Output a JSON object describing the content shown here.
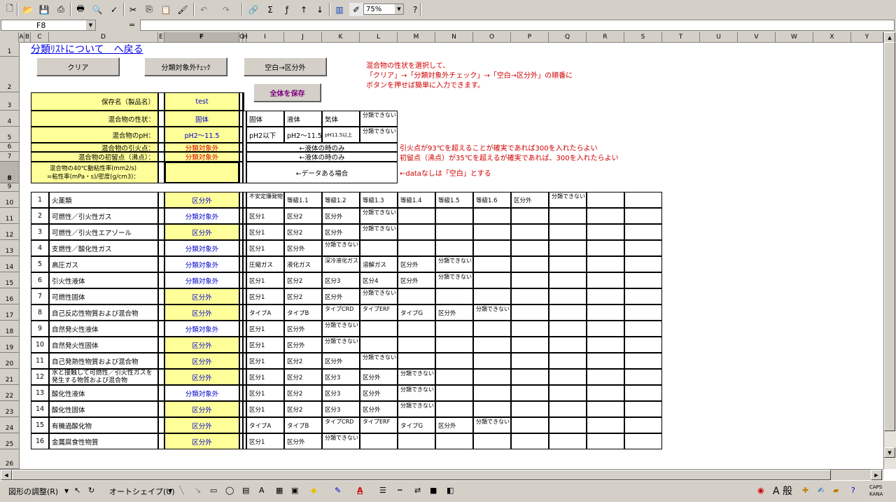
{
  "toolbar": {
    "zoom": "75%",
    "icons": [
      "new-icon",
      "open-icon",
      "save-icon",
      "print-setup-icon",
      "print-icon",
      "preview-icon",
      "spell-icon",
      "cut-icon",
      "copy-icon",
      "paste-icon",
      "format-painter-icon",
      "undo-icon",
      "redo-icon",
      "hyperlink-icon",
      "sum-icon",
      "function-icon",
      "sort-asc-icon",
      "sort-desc-icon",
      "chart-icon",
      "drawing-icon",
      "help-icon"
    ],
    "fx_glyph": "fx",
    "sigma_glyph": "Σ"
  },
  "formula_bar": {
    "name_box": "F8",
    "equals": "=",
    "value": ""
  },
  "columns": [
    "A",
    "B",
    "C",
    "D",
    "E",
    "F",
    "G",
    "H",
    "I",
    "J",
    "K",
    "L",
    "M",
    "N",
    "O",
    "P",
    "Q",
    "R",
    "S",
    "T",
    "U",
    "V",
    "W",
    "X",
    "Y"
  ],
  "rows": [
    "1",
    "2",
    "3",
    "4",
    "5",
    "6",
    "7",
    "8",
    "9",
    "10",
    "11",
    "12",
    "13",
    "14",
    "15",
    "16",
    "17",
    "18",
    "19",
    "20",
    "21",
    "22",
    "23",
    "24",
    "25",
    "26"
  ],
  "selected_cell": {
    "column": "F",
    "row": "8"
  },
  "sheet": {
    "link": "分類ﾘｽﾄについて　へ戻る",
    "buttons": {
      "clear": "クリア",
      "excluded_check": "分類対象外ﾁｪｯｸ",
      "blank_to_category": "空白→区分外",
      "save_all": "全体を保存"
    },
    "instructions": [
      "混合物の性状を選択して、",
      "「クリア」→「分類対象外チェック」→「空白→区分外」の順番に",
      "ボタンを押せば簡単に入力できます。"
    ],
    "props": [
      {
        "label": "保存名（製品名）",
        "value": "test",
        "color": "blue"
      },
      {
        "label": "混合物の性状：",
        "value": "固体",
        "color": "blue"
      },
      {
        "label": "混合物のpH：",
        "value": "pH2～11.5",
        "color": "blue"
      },
      {
        "label": "混合物の引火点：",
        "value": "分類対象外",
        "color": "red"
      },
      {
        "label": "混合物の初留点（沸点）：",
        "value": "分類対象外",
        "color": "red"
      },
      {
        "label": "混合物の40℃動粘性率(mm2/s)\n=粘性率(mPa・s)/密度(g/cm3)：",
        "value": "",
        "color": "blue"
      }
    ],
    "state_options": [
      "固体",
      "液体",
      "気体",
      "分類できない"
    ],
    "ph_options": [
      "pH2以下",
      "pH2～11.5",
      "pH11.5以上",
      "分類できない"
    ],
    "liquid_only_1": "←液体の時のみ",
    "liquid_only_2": "←液体の時のみ",
    "data_case": "←データある場合",
    "note_flash": "引火点が93℃を超えることが確実であれば300を入れたらよい",
    "note_boil": "初留点（沸点）が35℃を超えるが確実であれば、300を入れたらよい",
    "note_data": "←dataなしは「空白」とする",
    "hazards": [
      {
        "no": "1",
        "name": "火薬類",
        "result": "区分外",
        "opts": [
          "不安定爆発物",
          "等級1.1",
          "等級1.2",
          "等級1.3",
          "等級1.4",
          "等級1.5",
          "等級1.6",
          "区分外",
          "分類できない"
        ]
      },
      {
        "no": "2",
        "name": "可燃性／引火性ガス",
        "result": "分類対象外",
        "opts": [
          "区分1",
          "区分2",
          "区分外",
          "分類できない"
        ]
      },
      {
        "no": "3",
        "name": "可燃性／引火性エアゾール",
        "result": "区分外",
        "opts": [
          "区分1",
          "区分2",
          "区分外",
          "分類できない"
        ]
      },
      {
        "no": "4",
        "name": "支燃性／酸化性ガス",
        "result": "分類対象外",
        "opts": [
          "区分1",
          "区分外",
          "分類できない"
        ]
      },
      {
        "no": "5",
        "name": "高圧ガス",
        "result": "分類対象外",
        "opts": [
          "圧縮ガス",
          "液化ガス",
          "深冷液化ガス",
          "溶解ガス",
          "区分外",
          "分類できない"
        ]
      },
      {
        "no": "6",
        "name": "引火性液体",
        "result": "分類対象外",
        "opts": [
          "区分1",
          "区分2",
          "区分3",
          "区分4",
          "区分外",
          "分類できない"
        ]
      },
      {
        "no": "7",
        "name": "可燃性固体",
        "result": "区分外",
        "opts": [
          "区分1",
          "区分2",
          "区分外",
          "分類できない"
        ]
      },
      {
        "no": "8",
        "name": "自己反応性物質および混合物",
        "result": "区分外",
        "opts": [
          "タイプA",
          "タイプB",
          "タイプCRD",
          "タイプERF",
          "タイプG",
          "区分外",
          "分類できない"
        ]
      },
      {
        "no": "9",
        "name": "自然発火性液体",
        "result": "分類対象外",
        "opts": [
          "区分1",
          "区分外",
          "分類できない"
        ]
      },
      {
        "no": "10",
        "name": "自然発火性固体",
        "result": "区分外",
        "opts": [
          "区分1",
          "区分外",
          "分類できない"
        ]
      },
      {
        "no": "11",
        "name": "自己発熱性物質および混合物",
        "result": "区分外",
        "opts": [
          "区分1",
          "区分2",
          "区分外",
          "分類できない"
        ]
      },
      {
        "no": "12",
        "name": "水と接触して可燃性／引火性ガスを発生する物質および混合物",
        "result": "区分外",
        "opts": [
          "区分1",
          "区分2",
          "区分3",
          "区分外",
          "分類できない"
        ]
      },
      {
        "no": "13",
        "name": "酸化性液体",
        "result": "分類対象外",
        "opts": [
          "区分1",
          "区分2",
          "区分3",
          "区分外",
          "分類できない"
        ]
      },
      {
        "no": "14",
        "name": "酸化性固体",
        "result": "区分外",
        "opts": [
          "区分1",
          "区分2",
          "区分3",
          "区分外",
          "分類できない"
        ]
      },
      {
        "no": "15",
        "name": "有機過酸化物",
        "result": "区分外",
        "opts": [
          "タイプA",
          "タイプB",
          "タイプCRD",
          "タイプERF",
          "タイプG",
          "区分外",
          "分類できない"
        ]
      },
      {
        "no": "16",
        "name": "金属腐食性物質",
        "result": "区分外",
        "opts": [
          "区分1",
          "区分外",
          "分類できない"
        ]
      }
    ]
  },
  "drawing_bar": {
    "draw_menu": "図形の調整(R)",
    "autoshape_menu": "オートシェイプ(U)",
    "ime_label": "A 般",
    "caps": "CAPS",
    "kana": "KANA"
  },
  "colors": {
    "cell_yellow": "#ffff99",
    "value_blue": "#0000cc",
    "warning_red": "#d00000",
    "chrome": "#d4d0c8"
  }
}
